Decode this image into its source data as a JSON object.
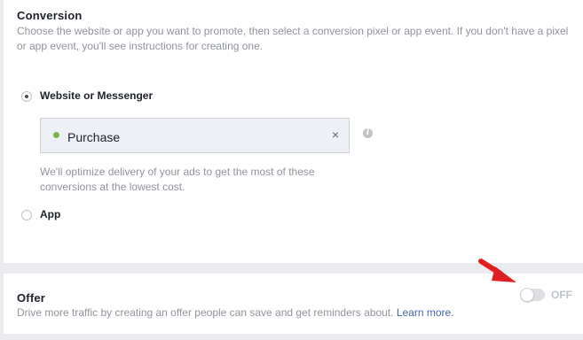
{
  "conversion": {
    "title": "Conversion",
    "description_line1": "Choose the website or app you want to promote, then select a conversion pixel or app event. If you don't have a pixel",
    "description_line2": "or app event, you'll see instructions for creating one.",
    "options": [
      {
        "label": "Website or Messenger",
        "selected": true
      },
      {
        "label": "App",
        "selected": false
      }
    ],
    "pixel": {
      "name": "Purchase",
      "status_color": "#7cb342",
      "clear_icon": "×",
      "info_icon": "i"
    },
    "helper_line1": "We'll optimize delivery of your ads to get the most of these",
    "helper_line2": "conversions at the lowest cost."
  },
  "offer": {
    "title": "Offer",
    "description": "Drive more traffic by creating an offer people can save and get reminders about.",
    "learn_more": "Learn more.",
    "toggle_state": "OFF",
    "toggle_on": false
  },
  "annotation": {
    "arrow_color": "#e02020",
    "arrow_icon": "red-arrow-icon"
  }
}
